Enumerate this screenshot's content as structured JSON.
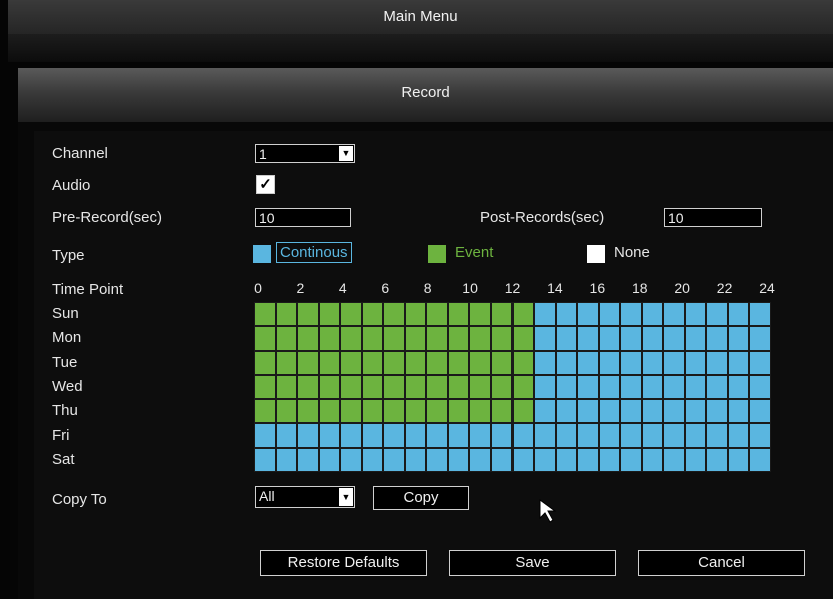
{
  "window": {
    "title": "Main Menu"
  },
  "dialog": {
    "title": "Record"
  },
  "fields": {
    "channel": {
      "label": "Channel",
      "value": "1"
    },
    "audio": {
      "label": "Audio",
      "checked": true
    },
    "pre_record": {
      "label": "Pre-Record(sec)",
      "value": "10"
    },
    "post_records": {
      "label": "Post-Records(sec)",
      "value": "10"
    },
    "type": {
      "label": "Type",
      "options": [
        {
          "label": "Continous",
          "color": "#5ab6e0"
        },
        {
          "label": "Event",
          "color": "#6db33f"
        },
        {
          "label": "None",
          "color": "#ffffff"
        }
      ]
    },
    "copy_to": {
      "label": "Copy To",
      "value": "All"
    }
  },
  "schedule": {
    "label": "Time Point",
    "hour_ticks": [
      "0",
      "2",
      "4",
      "6",
      "8",
      "10",
      "12",
      "14",
      "16",
      "18",
      "20",
      "22",
      "24"
    ],
    "days": [
      "Sun",
      "Mon",
      "Tue",
      "Wed",
      "Thu",
      "Fri",
      "Sat"
    ],
    "rows": [
      "eeeeeeeeeeeeeccccccccccc",
      "eeeeeeeeeeeeeccccccccccc",
      "eeeeeeeeeeeeeccccccccccc",
      "eeeeeeeeeeeeeccccccccccc",
      "eeeeeeeeeeeeeccccccccccc",
      "cccccccccccccccccccccccc",
      "cccccccccccccccccccccccc"
    ]
  },
  "buttons": {
    "copy": "Copy",
    "restore_defaults": "Restore Defaults",
    "save": "Save",
    "cancel": "Cancel"
  },
  "icons": {
    "dropdown": "chevron-down-icon",
    "checkbox": "checkmark-icon",
    "cursor": "mouse-pointer-icon"
  },
  "colors": {
    "continous": "#5ab6e0",
    "event": "#6db33f",
    "none": "#ffffff",
    "grid_line": "#1a1a1a"
  }
}
